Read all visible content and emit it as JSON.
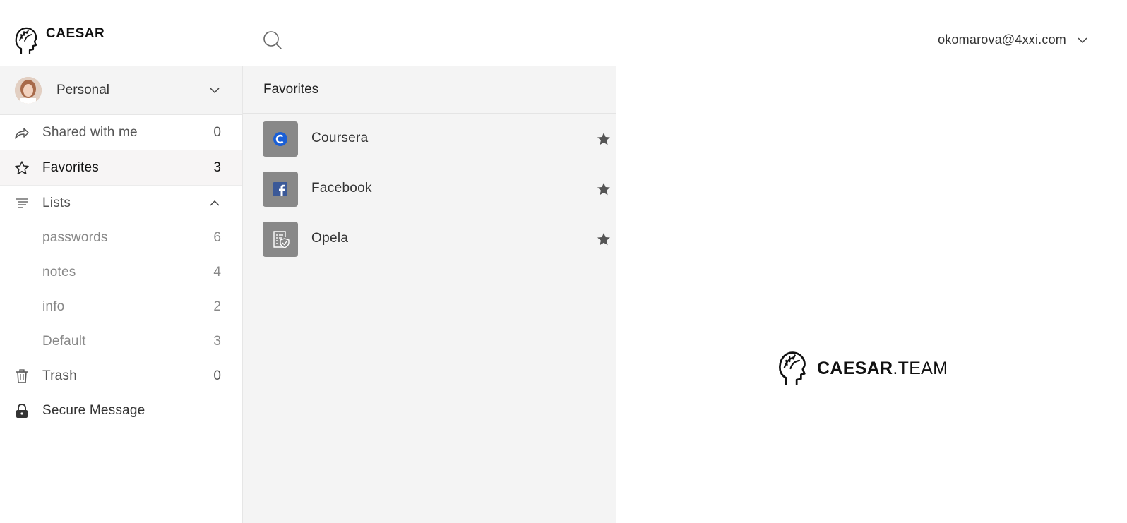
{
  "app": {
    "logo_text": "CAESAR"
  },
  "header": {
    "account_email": "okomarova@4xxi.com"
  },
  "sidebar": {
    "vault_name": "Personal",
    "items": [
      {
        "label": "Shared with me",
        "count": "0",
        "icon": "share-icon"
      },
      {
        "label": "Favorites",
        "count": "3",
        "icon": "star-outline-icon"
      },
      {
        "label": "Lists",
        "icon": "list-icon"
      },
      {
        "label": "passwords",
        "count": "6"
      },
      {
        "label": "notes",
        "count": "4"
      },
      {
        "label": "info",
        "count": "2"
      },
      {
        "label": "Default",
        "count": "3"
      },
      {
        "label": "Trash",
        "count": "0",
        "icon": "trash-icon"
      },
      {
        "label": "Secure Message",
        "icon": "lock-icon"
      }
    ]
  },
  "list": {
    "title": "Favorites",
    "entries": [
      {
        "name": "Coursera",
        "icon": "coursera-icon",
        "favorite": true
      },
      {
        "name": "Facebook",
        "icon": "facebook-icon",
        "favorite": true
      },
      {
        "name": "Opela",
        "icon": "document-shield-icon",
        "favorite": true
      }
    ]
  },
  "detail": {
    "brand_bold": "CAESAR",
    "brand_light": ".TEAM"
  },
  "colors": {
    "accent_blue": "#1a5fd6",
    "facebook_blue": "#3b5998",
    "thumb_gray": "#888888",
    "panel_gray": "#f4f4f4"
  }
}
